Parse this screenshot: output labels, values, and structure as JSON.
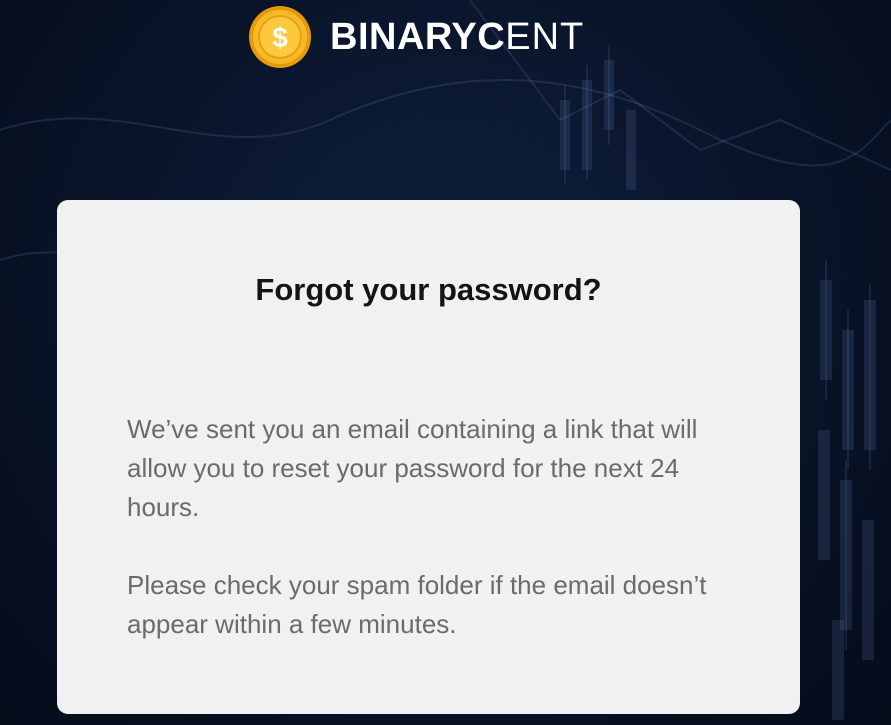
{
  "brand": {
    "name_bold": "BINARYC",
    "name_light": "ENT",
    "logo_icon": "dollar-coin-icon"
  },
  "card": {
    "title": "Forgot your password?",
    "paragraph1": "We’ve sent you an email containing a link that will allow you to reset your password for the next 24 hours.",
    "paragraph2": "Please check your spam folder if the email doesn’t appear within a few minutes."
  },
  "colors": {
    "background": "#0a162d",
    "card": "#f1f1f1",
    "title": "#141414",
    "body_text": "#6b6b6b",
    "coin": "#f5b21a"
  }
}
